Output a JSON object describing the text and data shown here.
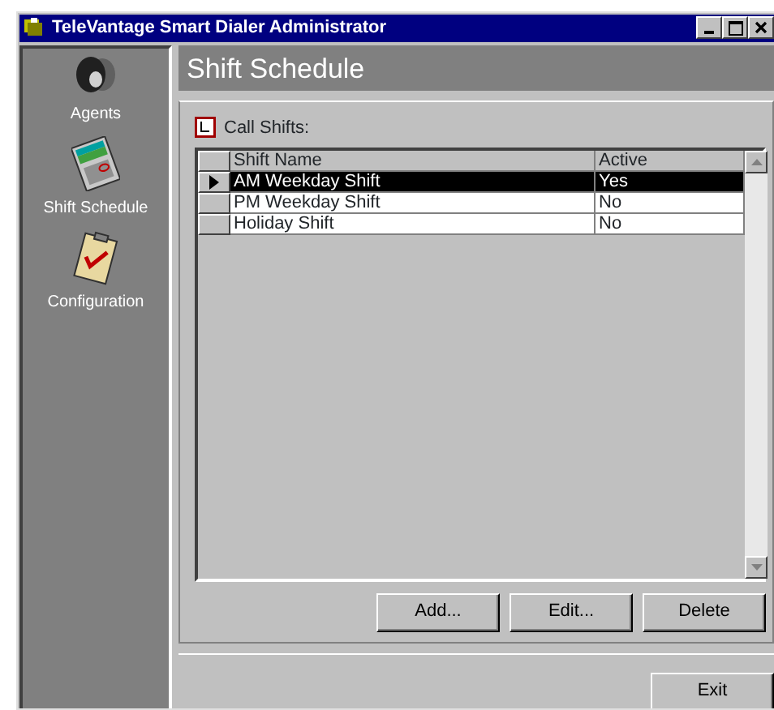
{
  "window": {
    "title": "TeleVantage Smart Dialer Administrator"
  },
  "sidebar": {
    "items": [
      {
        "label": "Agents",
        "kind": "agents"
      },
      {
        "label": "Shift Schedule",
        "kind": "schedule"
      },
      {
        "label": "Configuration",
        "kind": "config"
      }
    ]
  },
  "header": {
    "title": "Shift Schedule"
  },
  "call_shifts": {
    "label": "Call Shifts:",
    "table": {
      "columns": [
        "Shift Name",
        "Active"
      ],
      "rows": [
        {
          "cells": [
            "AM Weekday Shift",
            "Yes"
          ],
          "selected": true
        },
        {
          "cells": [
            "PM Weekday Shift",
            "No"
          ],
          "selected": false
        },
        {
          "cells": [
            "Holiday Shift",
            "No"
          ],
          "selected": false
        }
      ]
    },
    "buttons": [
      "Add...",
      "Edit...",
      "Delete"
    ]
  },
  "exit_button": "Exit"
}
